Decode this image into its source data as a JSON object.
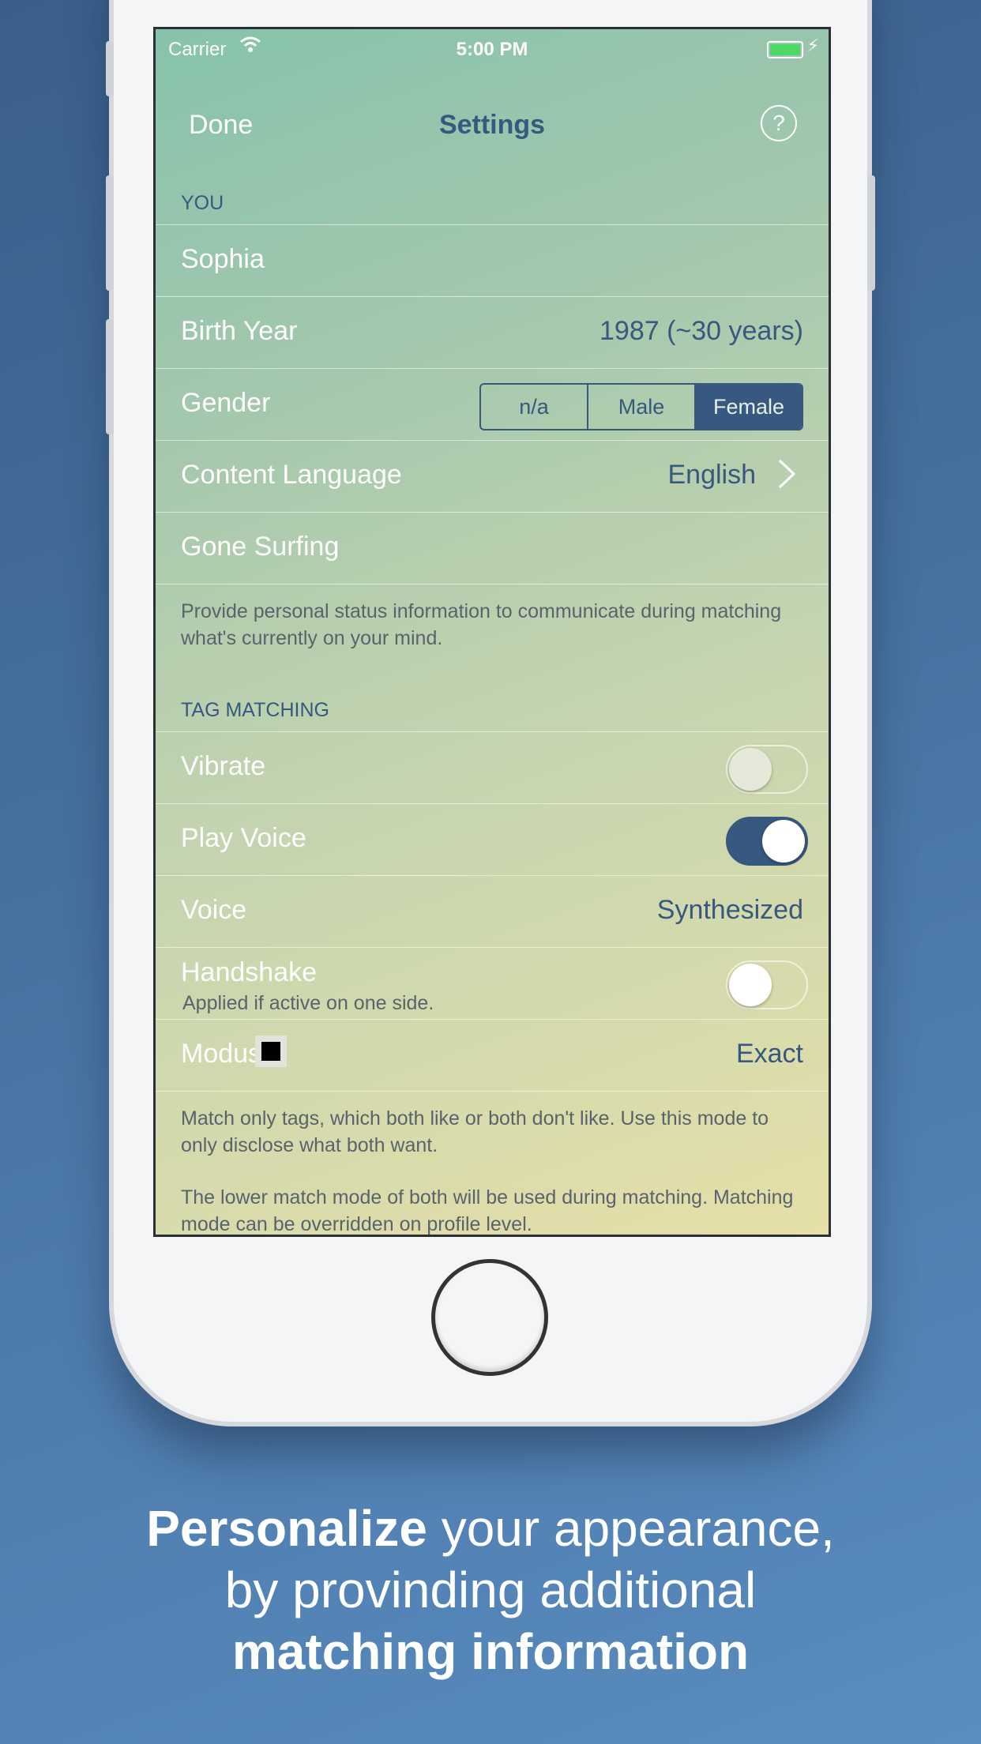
{
  "status": {
    "carrier": "Carrier",
    "time": "5:00 PM"
  },
  "nav": {
    "done": "Done",
    "title": "Settings",
    "help": "?"
  },
  "you": {
    "header": "YOU",
    "name": "Sophia",
    "birth_year_label": "Birth Year",
    "birth_year_value": "1987 (~30 years)",
    "gender_label": "Gender",
    "gender_options": [
      "n/a",
      "Male",
      "Female"
    ],
    "gender_selected": "Female",
    "content_language_label": "Content Language",
    "content_language_value": "English",
    "status_value": "Gone Surfing",
    "footer": "Provide personal status information to communicate during matching what's currently on your mind."
  },
  "tag_matching": {
    "header": "TAG MATCHING",
    "vibrate_label": "Vibrate",
    "vibrate_on": false,
    "play_voice_label": "Play Voice",
    "play_voice_on": true,
    "voice_label": "Voice",
    "voice_value": "Synthesized",
    "handshake_label": "Handshake",
    "handshake_subtitle": "Applied if active on one side.",
    "handshake_on": false,
    "modus_label": "Modus",
    "modus_value": "Exact",
    "footer_1": "Match only tags, which both like or both don't like. Use this mode to only disclose what both want.",
    "footer_2": "The lower match mode of both will be used during matching. Matching mode can be overridden on profile level."
  },
  "caption": {
    "bold_1": "Personalize",
    "text_1": " your appearance,",
    "text_2": "by provinding additional",
    "bold_2": "matching information"
  },
  "colors": {
    "accent": "#37587f",
    "background": "#4672a0",
    "battery": "#4cd964"
  }
}
